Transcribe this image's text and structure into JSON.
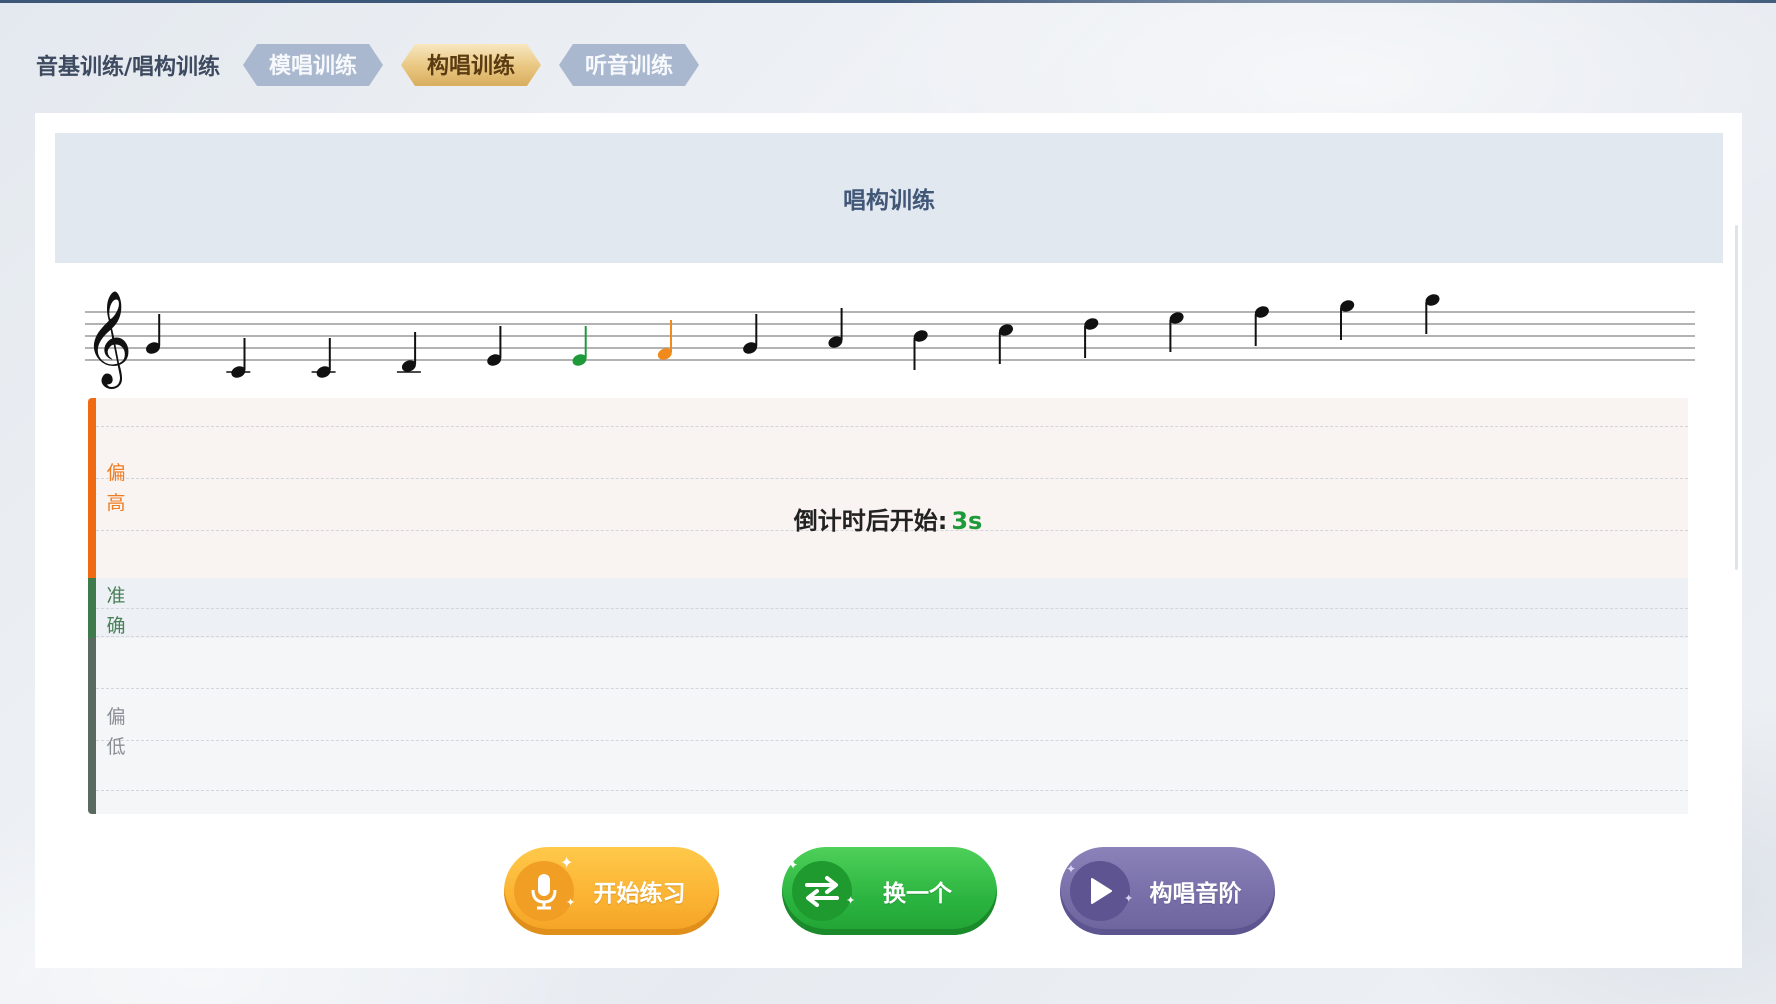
{
  "breadcrumb": "音基训练/唱构训练",
  "tabs": [
    {
      "label": "模唱训练",
      "active": false
    },
    {
      "label": "构唱训练",
      "active": true
    },
    {
      "label": "听音训练",
      "active": false
    }
  ],
  "panel": {
    "title": "唱构训练"
  },
  "staff": {
    "clef": "treble-clef",
    "note_colors": {
      "default": "#111111",
      "current": "#1f9a3b",
      "next": "#f08a1c"
    },
    "notes": [
      {
        "pitch": "G4",
        "state": "default"
      },
      {
        "pitch": "C4",
        "state": "default"
      },
      {
        "pitch": "C4",
        "state": "default"
      },
      {
        "pitch": "D4",
        "state": "default"
      },
      {
        "pitch": "E4",
        "state": "default"
      },
      {
        "pitch": "E4",
        "state": "current"
      },
      {
        "pitch": "F4",
        "state": "next"
      },
      {
        "pitch": "G4",
        "state": "default"
      },
      {
        "pitch": "A4",
        "state": "default"
      },
      {
        "pitch": "B4",
        "state": "default"
      },
      {
        "pitch": "C5",
        "state": "default"
      },
      {
        "pitch": "D5",
        "state": "default"
      },
      {
        "pitch": "E5",
        "state": "default"
      },
      {
        "pitch": "F5",
        "state": "default"
      },
      {
        "pitch": "G5",
        "state": "default"
      },
      {
        "pitch": "A5",
        "state": "default"
      }
    ]
  },
  "pitch_meter": {
    "high_label": "偏高",
    "accurate_label": "准确",
    "low_label": "偏低",
    "countdown_label": "倒计时后开始:",
    "countdown_value": "3s",
    "colors": {
      "high": "#f06a12",
      "accurate": "#3f7a4c",
      "low": "#5b6a60"
    }
  },
  "buttons": {
    "start": {
      "label": "开始练习",
      "icon": "microphone-icon"
    },
    "swap": {
      "label": "换一个",
      "icon": "swap-arrows-icon"
    },
    "scale": {
      "label": "构唱音阶",
      "icon": "play-icon"
    }
  }
}
